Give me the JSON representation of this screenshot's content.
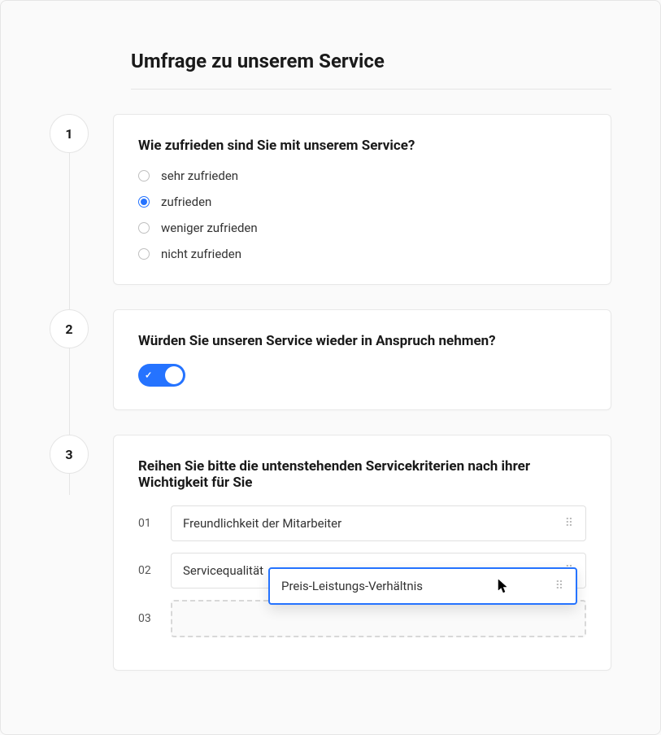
{
  "survey": {
    "title": "Umfrage zu unserem Service",
    "steps": [
      {
        "number": "1",
        "question": "Wie zufrieden sind Sie mit unserem Service?",
        "options": [
          {
            "label": "sehr zufrieden",
            "selected": false
          },
          {
            "label": "zufrieden",
            "selected": true
          },
          {
            "label": "weniger zufrieden",
            "selected": false
          },
          {
            "label": "nicht zufrieden",
            "selected": false
          }
        ]
      },
      {
        "number": "2",
        "question": "Würden Sie unseren Service wieder in Anspruch nehmen?",
        "toggle_value": true
      },
      {
        "number": "3",
        "question": "Reihen Sie bitte die untenstehenden Servicekriterien nach ihrer Wichtigkeit für Sie",
        "ranking": {
          "rows": [
            {
              "num": "01",
              "label": "Freundlichkeit der Mitarbeiter"
            },
            {
              "num": "02",
              "label": "Servicequalität"
            },
            {
              "num": "03",
              "label": ""
            }
          ],
          "dragging": "Preis-Leistungs-Verhältnis"
        }
      }
    ]
  }
}
